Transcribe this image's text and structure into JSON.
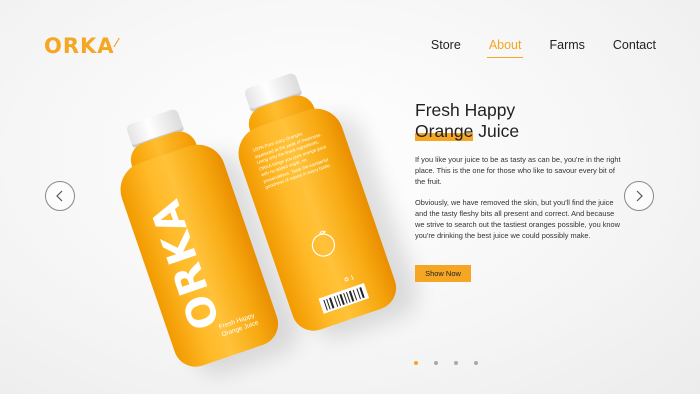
{
  "brand": {
    "name": "ORKA",
    "mark": "⁄",
    "color": "#f5a623"
  },
  "nav": {
    "items": [
      {
        "label": "Store",
        "active": false
      },
      {
        "label": "About",
        "active": true
      },
      {
        "label": "Farms",
        "active": false
      },
      {
        "label": "Contact",
        "active": false
      }
    ]
  },
  "hero": {
    "headline_line1": "Fresh Happy",
    "headline_highlight": "Orange",
    "headline_rest": " Juice",
    "paragraph1": "If you like your juice to be as tasty as can be, you're in the right place. This is the one for those who like to savour every bit of the fruit.",
    "paragraph2": "Obviously, we have removed the skin, but you'll find the juice and the tasty fleshy bits all present and correct. And because we strive to search out the tastiest oranges possible, you know you're drinking the best juice we could possibly make.",
    "cta_label": "Show Now"
  },
  "bottle_front": {
    "brand": "ORKA",
    "sub_line1": "Fresh Happy",
    "sub_line2": "Orange Juice"
  },
  "bottle_back": {
    "copy": "100% Pure Juicy Oranges squeezed at the peak of freshness. Using only the finest ingredients, ORKA brings you pure orange juice with no added sugar, no preservatives. Taste the wonderful goodness of nature in every bottle.",
    "recycle": "♻ 1"
  },
  "slider": {
    "slides": 4,
    "active_index": 0
  },
  "icons": {
    "prev": "chevron-left-icon",
    "next": "chevron-right-icon",
    "fruit": "orange-icon"
  }
}
